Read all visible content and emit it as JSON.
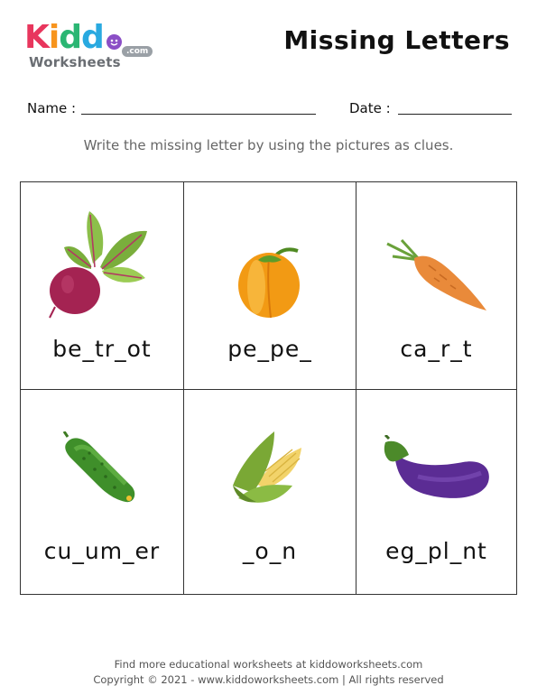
{
  "logo": {
    "letters": [
      "K",
      "i",
      "d",
      "d",
      "o"
    ],
    "letter_colors": [
      "#e8365d",
      "#f7941d",
      "#2bb673",
      "#29a9e0",
      "#8b4fc6"
    ],
    "sub": "Worksheets",
    "com": ".com"
  },
  "title": "Missing Letters",
  "fields": {
    "name_label": "Name :",
    "date_label": "Date :"
  },
  "instruction": "Write the missing letter by using the pictures as clues.",
  "cells": [
    {
      "word": "be_tr_ot",
      "icon": "beetroot-icon"
    },
    {
      "word": "pe_pe_",
      "icon": "pepper-icon"
    },
    {
      "word": "ca_r_t",
      "icon": "carrot-icon"
    },
    {
      "word": "cu_um_er",
      "icon": "cucumber-icon"
    },
    {
      "word": "_o_n",
      "icon": "corn-icon"
    },
    {
      "word": "eg_pl_nt",
      "icon": "eggplant-icon"
    }
  ],
  "footer": {
    "line1": "Find more educational worksheets at kiddoworksheets.com",
    "line2": "Copyright © 2021 - www.kiddoworksheets.com  |  All rights reserved"
  }
}
